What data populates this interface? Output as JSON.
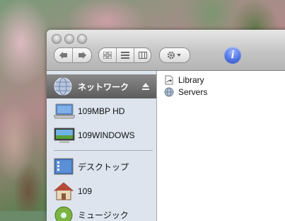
{
  "toolbar": {
    "back_icon": "back-arrow-icon",
    "forward_icon": "forward-arrow-icon",
    "view_icons": [
      "icon-view-icon",
      "list-view-icon",
      "column-view-icon"
    ],
    "action_icon": "gear-icon",
    "info_label": "i"
  },
  "sidebar": {
    "items": [
      {
        "label": "ネットワーク",
        "icon": "network-globe-icon",
        "selected": true
      },
      {
        "label": "109MBP HD",
        "icon": "laptop-icon"
      },
      {
        "label": "109WINDOWS",
        "icon": "windows-pc-icon"
      },
      {
        "label": "デスクトップ",
        "icon": "desktop-icon"
      },
      {
        "label": "109",
        "icon": "home-icon"
      },
      {
        "label": "ミュージック",
        "icon": "music-icon"
      }
    ]
  },
  "content": {
    "files": [
      {
        "name": "Library",
        "icon": "alias-folder-icon"
      },
      {
        "name": "Servers",
        "icon": "server-icon"
      }
    ]
  }
}
